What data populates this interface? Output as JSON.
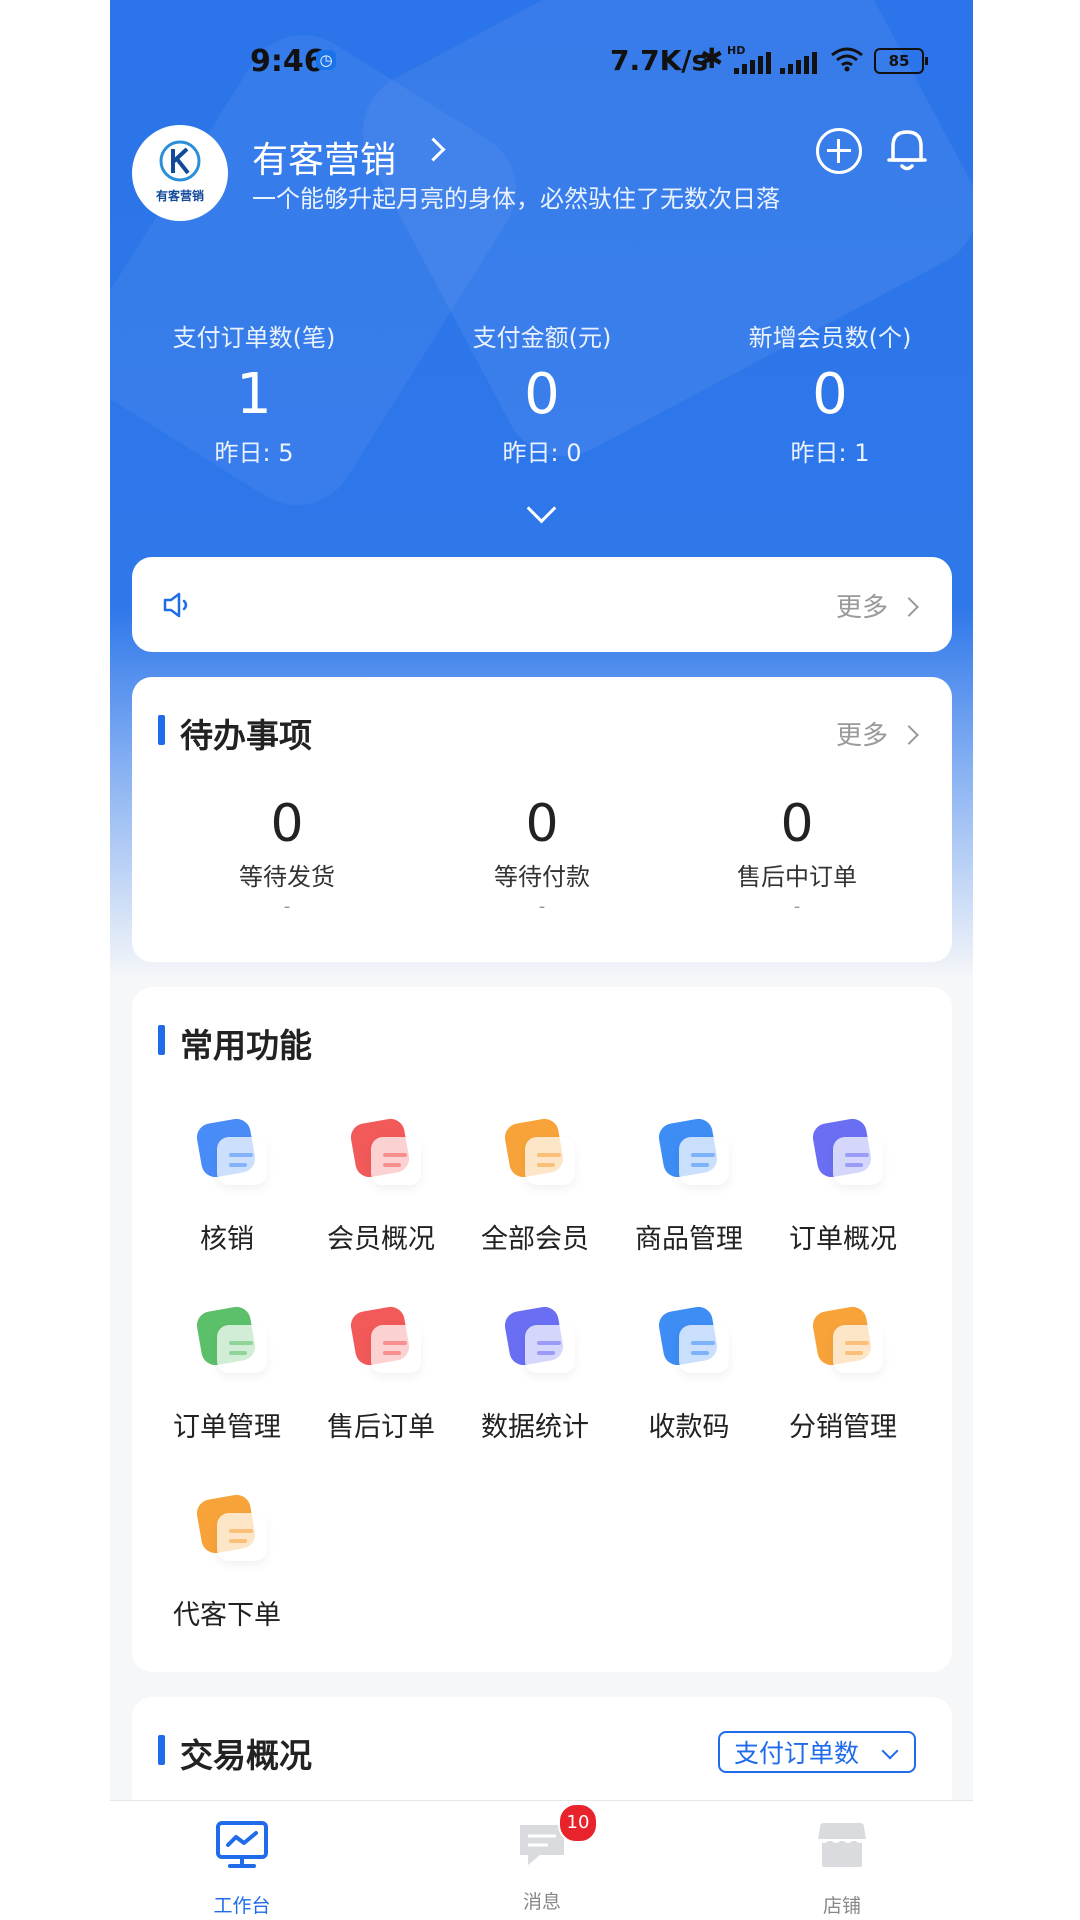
{
  "status_bar": {
    "time": "9:46",
    "network_speed": "7.7K/s",
    "hd_label": "HD",
    "battery": "85"
  },
  "profile": {
    "name": "有客营销",
    "motto": "一个能够升起月亮的身体，必然驮住了无数次日落",
    "logo_text": "有客营销"
  },
  "stats": [
    {
      "label": "支付订单数(笔)",
      "value": "1",
      "yesterday": "昨日: 5"
    },
    {
      "label": "支付金额(元)",
      "value": "0",
      "yesterday": "昨日: 0"
    },
    {
      "label": "新增会员数(个)",
      "value": "0",
      "yesterday": "昨日: 1"
    }
  ],
  "notice": {
    "more_label": "更多"
  },
  "todo": {
    "title": "待办事项",
    "more_label": "更多",
    "items": [
      {
        "value": "0",
        "label": "等待发货",
        "sub": "-"
      },
      {
        "value": "0",
        "label": "等待付款",
        "sub": "-"
      },
      {
        "value": "0",
        "label": "售后中订单",
        "sub": "-"
      }
    ]
  },
  "functions": {
    "title": "常用功能",
    "items": [
      {
        "label": "核销",
        "icon": "verify-icon",
        "color": "#4a8cf7"
      },
      {
        "label": "会员概况",
        "icon": "member-overview-icon",
        "color": "#f25a5a"
      },
      {
        "label": "全部会员",
        "icon": "all-members-icon",
        "color": "#f7a33a"
      },
      {
        "label": "商品管理",
        "icon": "cart-icon",
        "color": "#3d8df5"
      },
      {
        "label": "订单概况",
        "icon": "order-overview-icon",
        "color": "#6a6ef2"
      },
      {
        "label": "订单管理",
        "icon": "order-manage-icon",
        "color": "#5cbf6a"
      },
      {
        "label": "售后订单",
        "icon": "after-sale-icon",
        "color": "#f25a5a"
      },
      {
        "label": "数据统计",
        "icon": "data-stats-icon",
        "color": "#6a6ef2"
      },
      {
        "label": "收款码",
        "icon": "payment-code-icon",
        "color": "#3d8df5"
      },
      {
        "label": "分销管理",
        "icon": "distribution-icon",
        "color": "#f7a33a"
      },
      {
        "label": "代客下单",
        "icon": "proxy-order-icon",
        "color": "#f7a33a"
      }
    ]
  },
  "trade": {
    "title": "交易概况",
    "select_value": "支付订单数"
  },
  "tabs": [
    {
      "label": "工作台",
      "icon": "workbench-icon"
    },
    {
      "label": "消息",
      "icon": "message-icon",
      "badge": "10"
    },
    {
      "label": "店铺",
      "icon": "store-icon"
    }
  ],
  "colors": {
    "primary": "#1f6bea",
    "badge": "#e8232b"
  }
}
